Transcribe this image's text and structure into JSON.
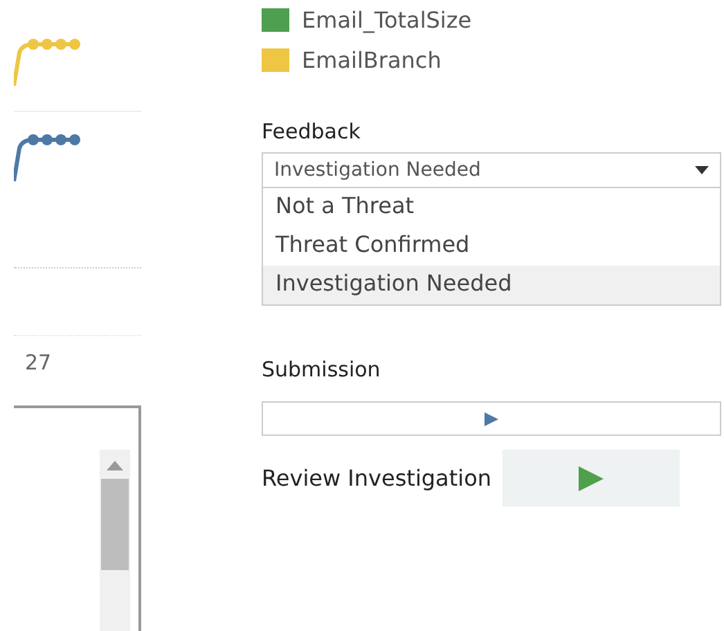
{
  "legend": [
    {
      "label": "Email_TotalSize",
      "color": "#4e9f50"
    },
    {
      "label": "EmailBranch",
      "color": "#eec643"
    }
  ],
  "left_panel": {
    "lines": [
      {
        "kind": "sparkline",
        "color": "#eec643"
      },
      {
        "kind": "sparkline",
        "color": "#4e79a7"
      }
    ],
    "axis_label": "27"
  },
  "feedback": {
    "label": "Feedback",
    "value": "Investigation Needed",
    "options": [
      {
        "label": "Not a Threat",
        "selected": false
      },
      {
        "label": "Threat Confirmed",
        "selected": false
      },
      {
        "label": "Investigation Needed",
        "selected": true
      }
    ]
  },
  "submission": {
    "label": "Submission"
  },
  "review": {
    "label": "Review Investigation"
  }
}
